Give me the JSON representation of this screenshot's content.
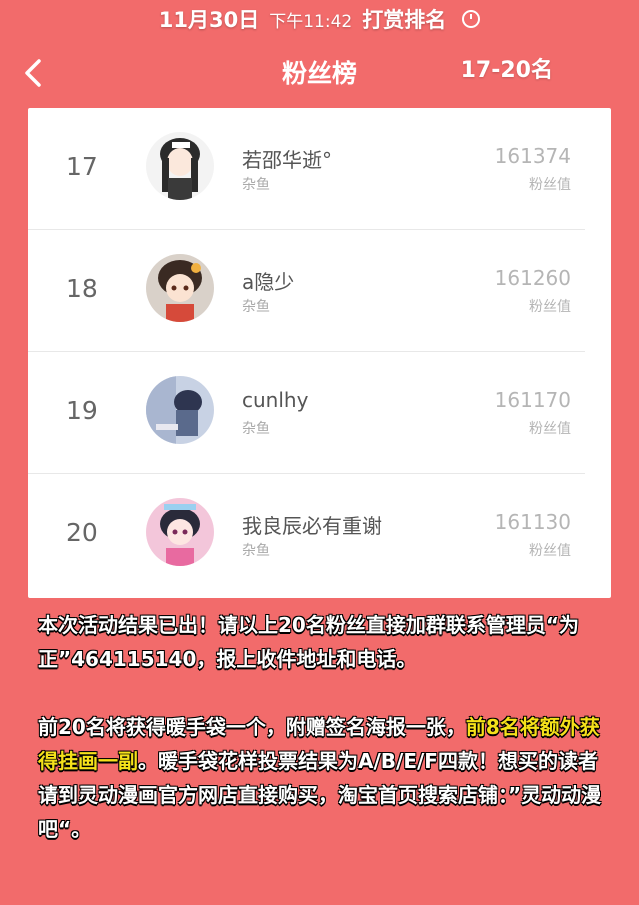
{
  "top_banner": {
    "date": "11月30日",
    "time": "下午11:42",
    "title": "打赏排名"
  },
  "nav": {
    "title": "粉丝榜",
    "range": "17-20名"
  },
  "leaderboard": [
    {
      "rank": "17",
      "name": "若邵华逝°",
      "tag": "杂鱼",
      "score": "161374",
      "score_label": "粉丝值"
    },
    {
      "rank": "18",
      "name": "a隐少",
      "tag": "杂鱼",
      "score": "161260",
      "score_label": "粉丝值"
    },
    {
      "rank": "19",
      "name": "cunlhy",
      "tag": "杂鱼",
      "score": "161170",
      "score_label": "粉丝值"
    },
    {
      "rank": "20",
      "name": "我良辰必有重谢",
      "tag": "杂鱼",
      "score": "161130",
      "score_label": "粉丝值"
    }
  ],
  "announcement": {
    "p1": "本次活动结果已出！请以上20名粉丝直接加群联系管理员“为正”464115140，报上收件地址和电话。",
    "p2_a": "前20名将获得暖手袋一个，附赠签名海报一张，",
    "p2_highlight": "前8名将额外获得挂画一副",
    "p2_b": "。暖手袋花样投票结果为A/B/E/F四款！想买的读者请到灵动漫画官方网店直接购买，淘宝首页搜索店铺：”灵动动漫吧“。"
  },
  "colors": {
    "background": "#f26b6b",
    "highlight": "#f5e11a"
  }
}
